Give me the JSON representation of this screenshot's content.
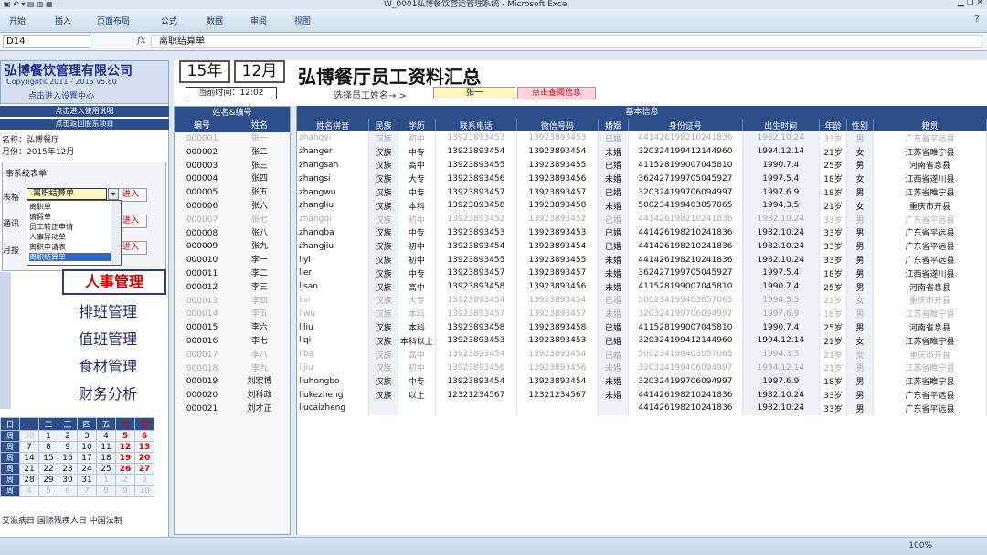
{
  "window": {
    "title": "W_0001弘博餐饮营运管理系统 - Microsoft Excel",
    "quick_access": "▣ ↶ ▾ ▤ ▥ ▦"
  },
  "ribbon": {
    "tabs": [
      "开始",
      "插入",
      "页面布局",
      "公式",
      "数据",
      "审阅",
      "视图"
    ]
  },
  "formula_bar": {
    "cell_ref": "D14",
    "fx": "fx",
    "value": "离职结算单"
  },
  "sidebar": {
    "company": "弘博餐饮管理有限公司",
    "copyright": "Copyright©2011 - 2015 v5.80",
    "enter_settings": "点击进入设置中心",
    "enter_help": "点击进入使用说明",
    "enter_back": "点击返回股东项目",
    "store_name": "名称：弘博餐厅",
    "month": "月份：2015年12月",
    "system_caption": "事系统表单",
    "label_form": "表格",
    "label_notice": "通讯",
    "label_month": "月报",
    "dropdown_value": "离职结算单",
    "dropdown_options": [
      "离职单",
      "请假单",
      "员工转正申请",
      "人事异动单",
      "离职申请表",
      "离职结算单"
    ],
    "enter_btn": "进入",
    "hr_button": "人事管理",
    "menu": [
      "排班管理",
      "值班管理",
      "食材管理",
      "财务分析"
    ]
  },
  "calendar": {
    "headers": [
      "日",
      "一",
      "二",
      "三",
      "四",
      "五",
      "六",
      "日"
    ],
    "weeks": [
      [
        "周",
        "30",
        "1",
        "2",
        "3",
        "4",
        "5",
        "6"
      ],
      [
        "周",
        "7",
        "8",
        "9",
        "10",
        "11",
        "12",
        "13"
      ],
      [
        "周",
        "14",
        "15",
        "16",
        "17",
        "18",
        "19",
        "20"
      ],
      [
        "周",
        "21",
        "22",
        "23",
        "24",
        "25",
        "26",
        "27"
      ],
      [
        "周",
        "28",
        "29",
        "30",
        "31",
        "1",
        "2",
        "3"
      ],
      [
        "周",
        "4",
        "5",
        "6",
        "7",
        "8",
        "9",
        "10"
      ]
    ],
    "holidays": "艾滋病日 国际残疾人日 中国法制"
  },
  "header": {
    "year": "15年",
    "month": "12月",
    "current_time": "当前时间：12:02",
    "title": "弘博餐厅员工资料汇总",
    "select_label": "选择员工姓名→ >",
    "selected_employee": "张一",
    "query_button": "点击查阅信息"
  },
  "name_panel": {
    "title": "姓名&编号",
    "col_id": "编号",
    "col_name": "姓名"
  },
  "main_table": {
    "banner": "基本信息",
    "columns": [
      "姓名拼音",
      "民族",
      "学历",
      "联系电话",
      "微信号码",
      "婚姻",
      "身份证号",
      "出生时间",
      "年龄",
      "性别",
      "籍贯"
    ],
    "rows": [
      {
        "id": "000001",
        "name": "张一",
        "dim": true,
        "cells": [
          "zhangyi",
          "汉族",
          "初中",
          "13923893453",
          "13923893453",
          "已婚",
          "441426198210241836",
          "1982.10.24",
          "33岁",
          "男",
          "广东省平远县"
        ]
      },
      {
        "id": "000002",
        "name": "张二",
        "dim": false,
        "cells": [
          "zhanger",
          "汉族",
          "中专",
          "13923893454",
          "13923893454",
          "未婚",
          "320324199412144960",
          "1994.12.14",
          "21岁",
          "女",
          "江苏省睢宁县"
        ]
      },
      {
        "id": "000003",
        "name": "张三",
        "dim": false,
        "cells": [
          "zhangsan",
          "汉族",
          "高中",
          "13923893455",
          "13923893455",
          "已婚",
          "411528199007045810",
          "1990.7.4",
          "25岁",
          "男",
          "河南省息县"
        ]
      },
      {
        "id": "000004",
        "name": "张四",
        "dim": false,
        "cells": [
          "zhangsi",
          "汉族",
          "大专",
          "13923893456",
          "13923893456",
          "未婚",
          "362427199705045927",
          "1997.5.4",
          "18岁",
          "女",
          "江西省遂川县"
        ]
      },
      {
        "id": "000005",
        "name": "张五",
        "dim": false,
        "cells": [
          "zhangwu",
          "汉族",
          "中专",
          "13923893457",
          "13923893457",
          "已婚",
          "320324199706094997",
          "1997.6.9",
          "18岁",
          "男",
          "江苏省睢宁县"
        ]
      },
      {
        "id": "000006",
        "name": "张六",
        "dim": false,
        "cells": [
          "zhangliu",
          "汉族",
          "本科",
          "13923893458",
          "13923893458",
          "未婚",
          "500234199403057065",
          "1994.3.5",
          "21岁",
          "女",
          "重庆市开县"
        ]
      },
      {
        "id": "000007",
        "name": "张七",
        "dim": true,
        "cells": [
          "zhangqi",
          "汉族",
          "初中",
          "13923893452",
          "13923893452",
          "已婚",
          "441426198210241836",
          "1982.10.24",
          "33岁",
          "男",
          "广东省平远县"
        ]
      },
      {
        "id": "000008",
        "name": "张八",
        "dim": false,
        "cells": [
          "zhangba",
          "汉族",
          "中专",
          "13923893453",
          "13923893453",
          "已婚",
          "441426198210241836",
          "1982.10.24",
          "33岁",
          "男",
          "广东省平远县"
        ]
      },
      {
        "id": "000009",
        "name": "张九",
        "dim": false,
        "cells": [
          "zhangjiu",
          "汉族",
          "初中",
          "13923893454",
          "13923893454",
          "已婚",
          "441426198210241836",
          "1982.10.24",
          "33岁",
          "男",
          "广东省平远县"
        ]
      },
      {
        "id": "000010",
        "name": "李一",
        "dim": false,
        "cells": [
          "liyi",
          "汉族",
          "初中",
          "13923893455",
          "13923893455",
          "未婚",
          "441426198210241836",
          "1982.10.24",
          "33岁",
          "男",
          "广东省平远县"
        ]
      },
      {
        "id": "000011",
        "name": "李二",
        "dim": false,
        "cells": [
          "lier",
          "汉族",
          "中专",
          "13923893457",
          "13923893457",
          "未婚",
          "362427199705045927",
          "1997.5.4",
          "18岁",
          "男",
          "江西省遂川县"
        ]
      },
      {
        "id": "000012",
        "name": "李三",
        "dim": false,
        "cells": [
          "lisan",
          "汉族",
          "高中",
          "13923893458",
          "13923893456",
          "未婚",
          "411528199007045810",
          "1990.7.4",
          "25岁",
          "男",
          "河南省息县"
        ]
      },
      {
        "id": "000013",
        "name": "李四",
        "dim": true,
        "cells": [
          "lisi",
          "汉族",
          "大专",
          "13923893454",
          "13923893454",
          "已婚",
          "500234199403057065",
          "1994.3.5",
          "21岁",
          "女",
          "重庆市开县"
        ]
      },
      {
        "id": "000014",
        "name": "李五",
        "dim": true,
        "cells": [
          "liwu",
          "汉族",
          "本科",
          "13923893457",
          "13923893457",
          "未婚",
          "320324199706094997",
          "1997.6.9",
          "18岁",
          "男",
          "江苏省睢宁县"
        ]
      },
      {
        "id": "000015",
        "name": "李六",
        "dim": false,
        "cells": [
          "liliu",
          "汉族",
          "本科",
          "13923893458",
          "13923893458",
          "已婚",
          "411528199007045810",
          "1990.7.4",
          "25岁",
          "男",
          "河南省息县"
        ]
      },
      {
        "id": "000016",
        "name": "李七",
        "dim": false,
        "cells": [
          "liqi",
          "汉族",
          "本科以上",
          "13923893453",
          "13923893453",
          "已婚",
          "320324199412144960",
          "1994.12.14",
          "21岁",
          "女",
          "江苏省睢宁县"
        ]
      },
      {
        "id": "000017",
        "name": "李八",
        "dim": true,
        "cells": [
          "liba",
          "汉族",
          "高中",
          "13923893454",
          "13923893454",
          "已婚",
          "500234199403057065",
          "1994.3.5",
          "21岁",
          "女",
          "重庆市开县"
        ]
      },
      {
        "id": "000018",
        "name": "李九",
        "dim": true,
        "cells": [
          "lijiu",
          "汉族",
          "初中",
          "13923893456",
          "13923893456",
          "未婚",
          "320324199406094997",
          "1994.12.14",
          "21岁",
          "男",
          "江苏省睢宁县"
        ]
      },
      {
        "id": "000019",
        "name": "刘宏博",
        "dim": false,
        "cells": [
          "liuhongbo",
          "汉族",
          "中专",
          "13923893454",
          "13923893454",
          "未婚",
          "320324199706094997",
          "1997.6.9",
          "18岁",
          "男",
          "江苏省睢宁县"
        ]
      },
      {
        "id": "000020",
        "name": "刘科政",
        "dim": false,
        "cells": [
          "liukezheng",
          "汉族",
          "以上",
          "12321234567",
          "12321234567",
          "未婚",
          "441426198210241836",
          "1982.10.24",
          "33岁",
          "男",
          "广东省平远县"
        ]
      },
      {
        "id": "000021",
        "name": "刘才正",
        "dim": false,
        "cells": [
          "liucaizheng",
          "",
          "",
          "",
          "",
          "",
          "441426198210241836",
          "1982.10.24",
          "33岁",
          "男",
          "广东省平远县"
        ]
      }
    ]
  },
  "status": {
    "zoom": "100%"
  },
  "colors": {
    "header_blue": "#2c4f8c",
    "accent_red": "#d40000",
    "input_yellow": "#fff7c0"
  }
}
